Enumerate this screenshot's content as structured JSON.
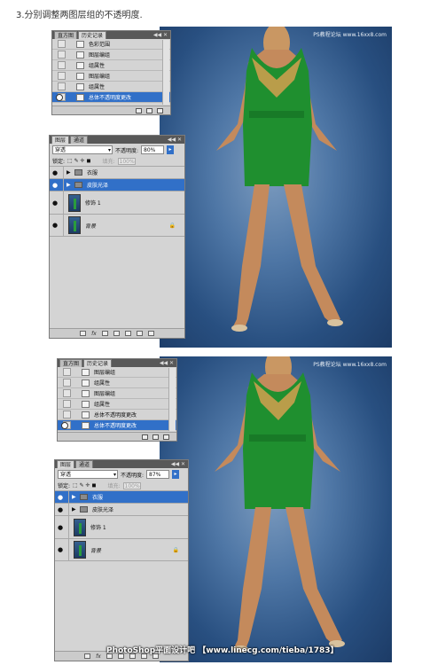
{
  "step_text": "3.分别调整两图层组的不透明度.",
  "watermark": "PS教程论坛 www.16xx8.com",
  "bottom_watermark": "PhotoShop平面设计吧 【www.linecg.com/tieba/1783】",
  "panel_controls": "◀◀ ✕",
  "history_tabs": [
    "直方图",
    "历史记录"
  ],
  "top": {
    "history_items": [
      "色彩范围",
      "图层编组",
      "组属性",
      "图层编组",
      "组属性",
      "总体不透明度更改"
    ],
    "blend_mode": "穿透",
    "opacity_label": "不透明度:",
    "opacity_value": "80%"
  },
  "bottom": {
    "history_items": [
      "图层编组",
      "组属性",
      "图层编组",
      "组属性",
      "总体不透明度更改",
      "总体不透明度更改"
    ],
    "blend_mode": "穿透",
    "opacity_label": "不透明度:",
    "opacity_value": "87%"
  },
  "layers_tabs": [
    "图层",
    "通道"
  ],
  "lock_label": "锁定:",
  "lock_icons": "⬚ ✎ ✛ ◼",
  "fill_label": "填充:",
  "fill_value": "100%",
  "layers": {
    "clothes": "衣服",
    "skin": "皮肤光泽",
    "retouch": "修饰 1",
    "background": "背景"
  },
  "layers_footer_fx": "fx",
  "eye_glyph": "●",
  "expand_glyph": "▶",
  "lock_glyph": "🔒",
  "colors": {
    "selection": "#3170c8",
    "panel": "#d4d4d4",
    "backdrop": "#284f80",
    "dress": "#1f8f2f"
  }
}
